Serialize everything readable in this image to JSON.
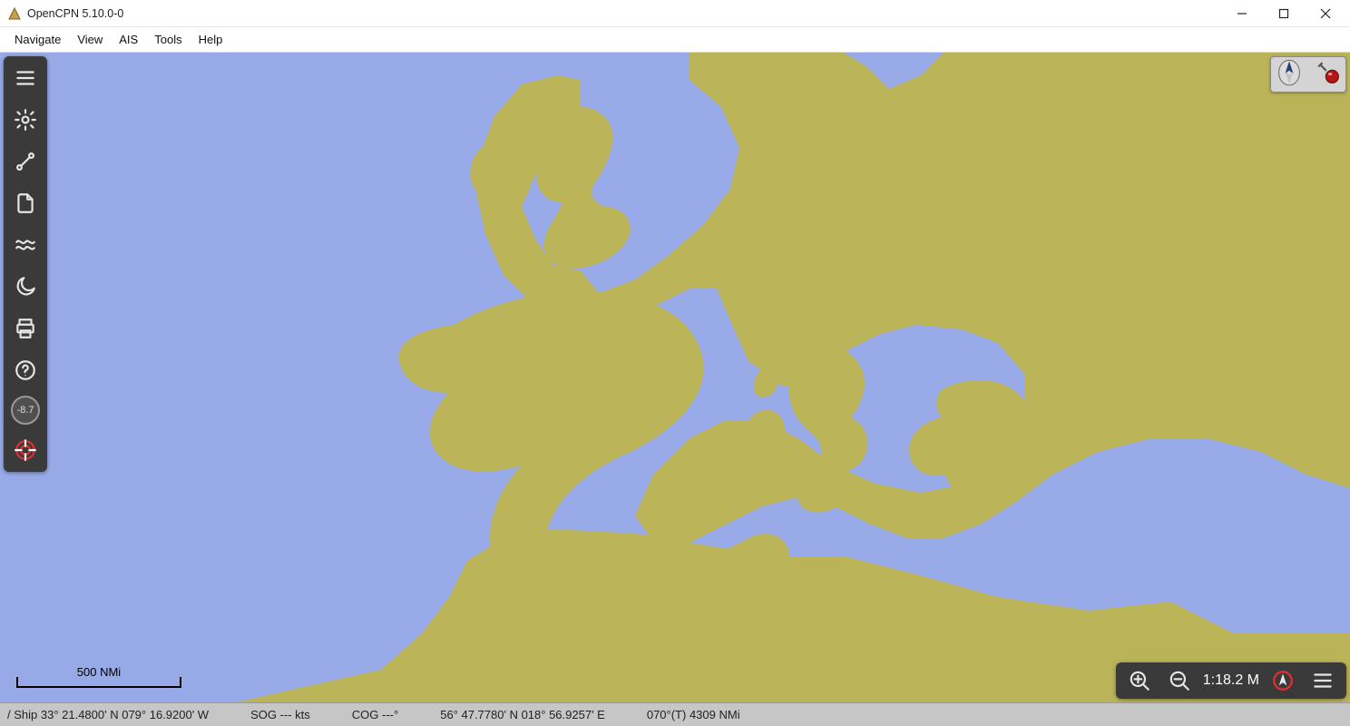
{
  "titlebar": {
    "title": "OpenCPN 5.10.0-0"
  },
  "menubar": {
    "items": [
      "Navigate",
      "View",
      "AIS",
      "Tools",
      "Help"
    ]
  },
  "left_tools": {
    "badge_value": "-8.7"
  },
  "scale_indicator": {
    "label": "500 NMi"
  },
  "bottom_controls": {
    "scale_readout": "1:18.2 M"
  },
  "statusbar": {
    "ship_pos": "/ Ship 33° 21.4800' N   079° 16.9200' W",
    "sog": "SOG --- kts",
    "cog": "COG ---°",
    "cursor_pos": "56° 47.7780' N   018° 56.9257' E",
    "bearing_dist": "070°(T)   4309 NMi"
  },
  "map": {
    "region_hint": "Europe / Mediterranean / North Africa",
    "colors": {
      "water": "#97a9e6",
      "land": "#bab358"
    }
  }
}
